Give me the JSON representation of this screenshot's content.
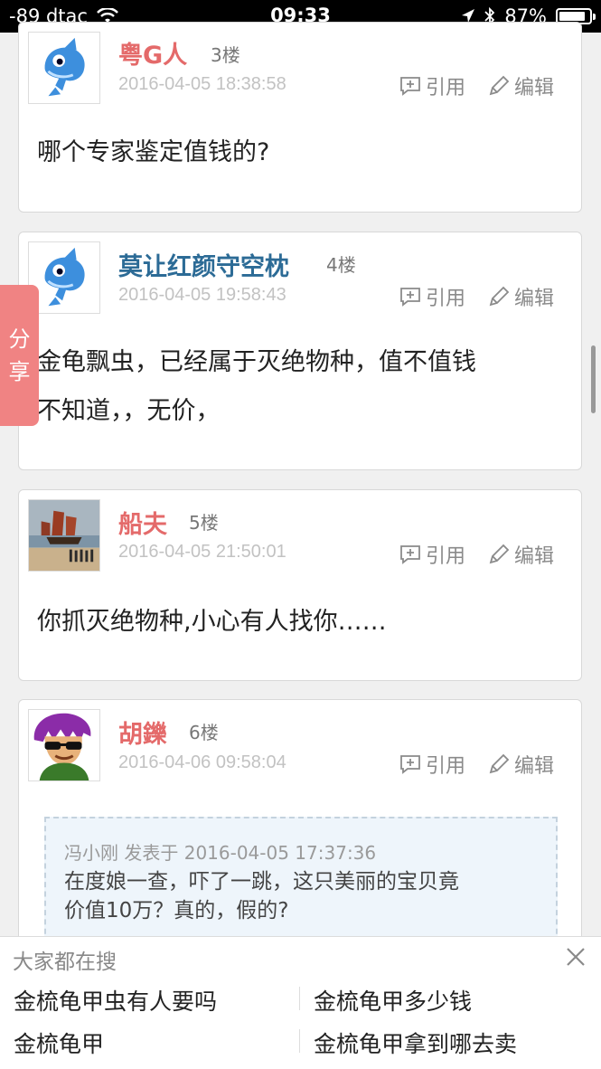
{
  "status_bar": {
    "carrier": "-89 dtac",
    "time": "09:33",
    "battery": "87%",
    "battery_level": 0.87
  },
  "actions": {
    "quote_label": "引用",
    "edit_label": "编辑"
  },
  "share_label": [
    "分",
    "享"
  ],
  "posts": [
    {
      "username": "粤G人",
      "floor": "3楼",
      "date": "2016-04-05 18:38:58",
      "content": [
        "哪个专家鉴定值钱的?"
      ]
    },
    {
      "username": "莫让红颜守空枕",
      "floor": "4楼",
      "date": "2016-04-05 19:58:43",
      "content": [
        "金龟飘虫，已经属于灭绝物种，值不值钱",
        "不知道，，无价，"
      ]
    },
    {
      "username": "船夫",
      "floor": "5楼",
      "date": "2016-04-05 21:50:01",
      "content": [
        "你抓灭绝物种,小心有人找你……"
      ]
    },
    {
      "username": "胡鑠",
      "floor": "6楼",
      "date": "2016-04-06 09:58:04",
      "quote": {
        "meta": "冯小刚 发表于 2016-04-05 17:37:36",
        "lines": [
          "在度娘一查，吓了一跳，这只美丽的宝贝竟",
          "价值10万？真的，假的?"
        ]
      }
    }
  ],
  "search_panel": {
    "title": "大家都在搜",
    "items": [
      "金梳龟甲虫有人要吗",
      "金梳龟甲多少钱",
      "金梳龟甲",
      "金梳龟甲拿到哪去卖"
    ]
  },
  "colors": {
    "name_red": "#e46a6a",
    "name_blue": "#2c6b96",
    "share_bg": "#f08383"
  },
  "icons": [
    "wifi-icon",
    "location-arrow-icon",
    "bluetooth-icon",
    "battery-icon",
    "quote-icon",
    "pencil-icon",
    "close-icon"
  ]
}
